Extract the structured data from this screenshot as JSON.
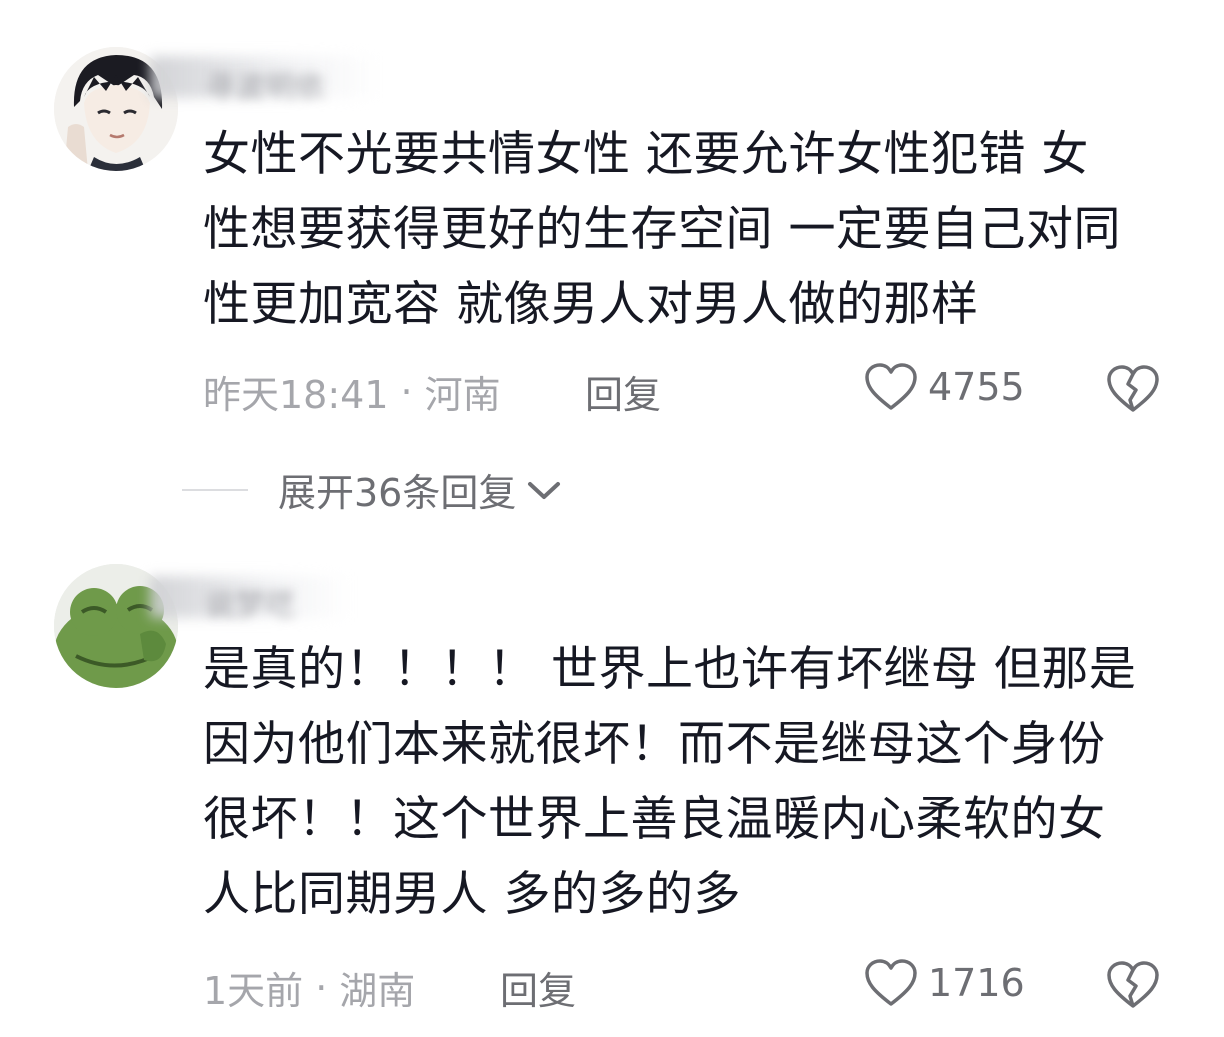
{
  "comments": [
    {
      "username": "寻波明依",
      "text_lines": [
        "女性不光要共情女性 还要允许女性犯错 女",
        "性想要获得更好的生存空间 一定要自己对同",
        "性更加宽容 就像男人对男人做的那样"
      ],
      "time": "昨天18:41",
      "separator": "·",
      "location": "河南",
      "reply_label": "回复",
      "likes": "4755",
      "avatar_icon": "anime-avatar",
      "replies_expand": "展开36条回复"
    },
    {
      "username": "说梦呓",
      "text_lines": [
        "是真的！！！！ 世界上也许有坏继母 但那是",
        "因为他们本来就很坏！而不是继母这个身份",
        "很坏！！这个世界上善良温暖内心柔软的女",
        "人比同期男人 多的多的多"
      ],
      "time": "1天前",
      "separator": "·",
      "location": "湖南",
      "reply_label": "回复",
      "likes": "1716",
      "avatar_icon": "frog-avatar"
    }
  ],
  "icons": {
    "like": "heart-outline-icon",
    "dislike": "broken-heart-icon",
    "expand": "chevron-down-icon"
  },
  "colors": {
    "text": "#161823",
    "meta": "#a5a6ab",
    "action": "#6d6e73"
  }
}
